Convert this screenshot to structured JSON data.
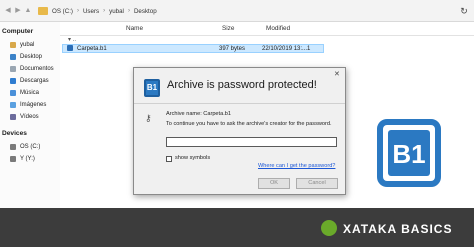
{
  "explorer": {
    "breadcrumb": [
      "OS (C:)",
      "Users",
      "yubal",
      "Desktop"
    ],
    "columns": {
      "name": "Name",
      "size": "Size",
      "modified": "Modified"
    },
    "rows": [
      {
        "name": "Carpeta.b1",
        "size": "397 bytes",
        "modified": "22/10/2019 13:...1"
      }
    ]
  },
  "sidebar": {
    "computer": "Computer",
    "devices": "Devices",
    "items": [
      "yubal",
      "Desktop",
      "Documentos",
      "Descargas",
      "Música",
      "Imágenes",
      "Vídeos"
    ],
    "drives": [
      "OS (C:)",
      "Y (Y:)"
    ]
  },
  "dialog": {
    "title": "Archive is password protected!",
    "archive_label": "Archive name: Carpeta.b1",
    "instruction": "To continue you have to ask the archive's creator for the password.",
    "show_symbols": "show symbols",
    "link": "Where can I get the password?",
    "ok": "OK",
    "cancel": "Cancel",
    "logo_text": "B1"
  },
  "brand_logo": "B1",
  "footer": {
    "brand": "XATAKA BASICS"
  },
  "colors": {
    "footer_bg": "#3c3c3c",
    "logo_blue": "#2b79c2",
    "brand_green": "#6aaa2a"
  }
}
